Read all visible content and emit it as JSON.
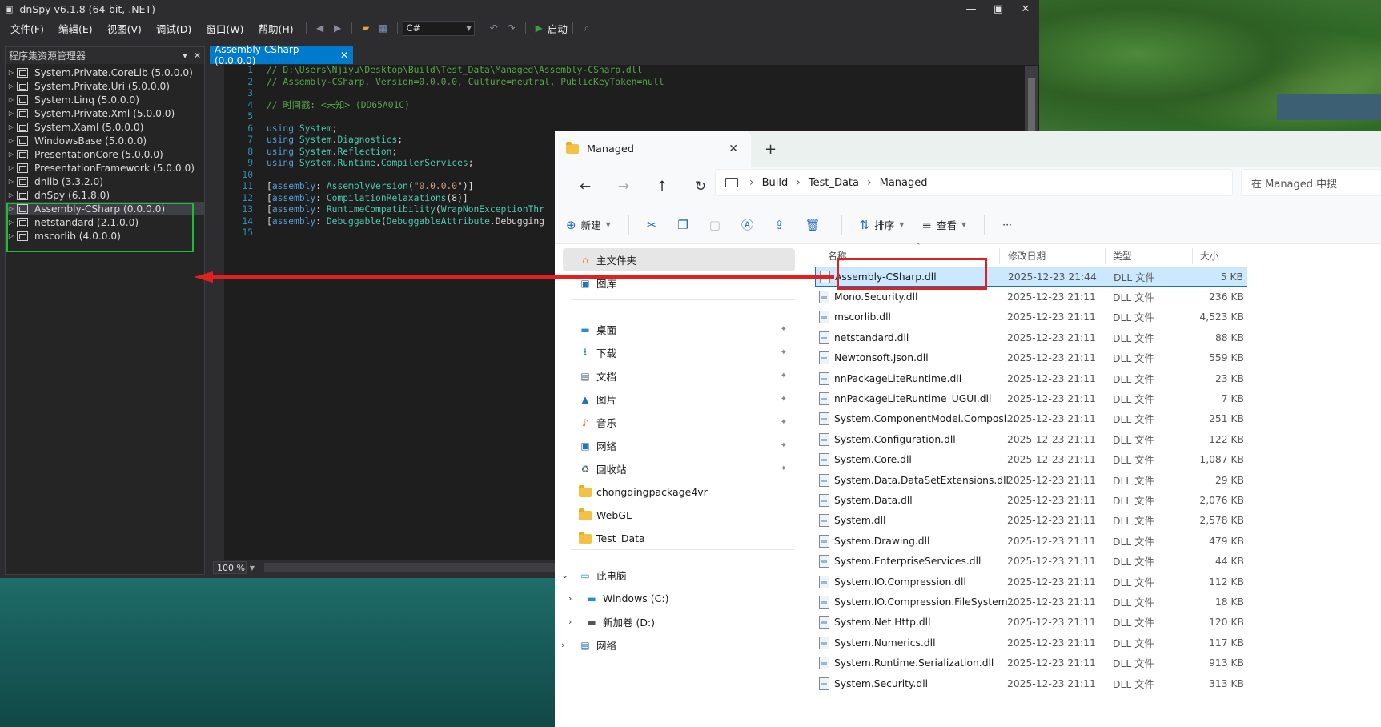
{
  "dnspy": {
    "title": "dnSpy v6.1.8 (64-bit, .NET)",
    "menu": [
      "文件(F)",
      "编辑(E)",
      "视图(V)",
      "调试(D)",
      "窗口(W)",
      "帮助(H)"
    ],
    "language": "C#",
    "start_label": "启动",
    "explorer_title": "程序集资源管理器",
    "tree": [
      "System.Private.CoreLib (5.0.0.0)",
      "System.Private.Uri (5.0.0.0)",
      "System.Linq (5.0.0.0)",
      "System.Private.Xml (5.0.0.0)",
      "System.Xaml (5.0.0.0)",
      "WindowsBase (5.0.0.0)",
      "PresentationCore (5.0.0.0)",
      "PresentationFramework (5.0.0.0)",
      "dnlib (3.3.2.0)",
      "dnSpy (6.1.8.0)",
      "Assembly-CSharp (0.0.0.0)",
      "netstandard (2.1.0.0)",
      "mscorlib (4.0.0.0)"
    ],
    "selected_tree_index": 10,
    "tab_label": "Assembly-CSharp (0.0.0.0)",
    "code": [
      {
        "n": "1",
        "segs": [
          [
            "cmt",
            "// D:\\Users\\Njiyu\\Desktop\\Build\\Test_Data\\Managed\\Assembly-CSharp.dll"
          ]
        ]
      },
      {
        "n": "2",
        "segs": [
          [
            "cmt",
            "// Assembly-CSharp, Version=0.0.0.0, Culture=neutral, PublicKeyToken=null"
          ]
        ]
      },
      {
        "n": "3",
        "segs": []
      },
      {
        "n": "4",
        "segs": [
          [
            "cmt",
            "// 时间戳: <未知> (DD65A01C)"
          ]
        ]
      },
      {
        "n": "5",
        "segs": []
      },
      {
        "n": "6",
        "segs": [
          [
            "kw",
            "using "
          ],
          [
            "ty",
            "System"
          ],
          [
            "pl",
            ";"
          ]
        ]
      },
      {
        "n": "7",
        "segs": [
          [
            "kw",
            "using "
          ],
          [
            "ty",
            "System"
          ],
          [
            "pl",
            "."
          ],
          [
            "ty",
            "Diagnostics"
          ],
          [
            "pl",
            ";"
          ]
        ]
      },
      {
        "n": "8",
        "segs": [
          [
            "kw",
            "using "
          ],
          [
            "ty",
            "System"
          ],
          [
            "pl",
            "."
          ],
          [
            "ty",
            "Reflection"
          ],
          [
            "pl",
            ";"
          ]
        ]
      },
      {
        "n": "9",
        "segs": [
          [
            "kw",
            "using "
          ],
          [
            "ty",
            "System"
          ],
          [
            "pl",
            "."
          ],
          [
            "ty",
            "Runtime"
          ],
          [
            "pl",
            "."
          ],
          [
            "ty",
            "CompilerServices"
          ],
          [
            "pl",
            ";"
          ]
        ]
      },
      {
        "n": "10",
        "segs": []
      },
      {
        "n": "11",
        "segs": [
          [
            "pl",
            "["
          ],
          [
            "kw",
            "assembly"
          ],
          [
            "pl",
            ": "
          ],
          [
            "ty",
            "AssemblyVersion"
          ],
          [
            "pl",
            "("
          ],
          [
            "st",
            "\"0.0.0.0\""
          ],
          [
            "pl",
            ")]"
          ]
        ]
      },
      {
        "n": "12",
        "segs": [
          [
            "pl",
            "["
          ],
          [
            "kw",
            "assembly"
          ],
          [
            "pl",
            ": "
          ],
          [
            "ty",
            "CompilationRelaxations"
          ],
          [
            "pl",
            "(8)]"
          ]
        ]
      },
      {
        "n": "13",
        "segs": [
          [
            "pl",
            "["
          ],
          [
            "kw",
            "assembly"
          ],
          [
            "pl",
            ": "
          ],
          [
            "ty",
            "RuntimeCompatibility"
          ],
          [
            "pl",
            "("
          ],
          [
            "dim",
            "WrapNonExceptionThr"
          ]
        ]
      },
      {
        "n": "14",
        "segs": [
          [
            "pl",
            "["
          ],
          [
            "kw",
            "assembly"
          ],
          [
            "pl",
            ": "
          ],
          [
            "ty",
            "Debuggable"
          ],
          [
            "pl",
            "("
          ],
          [
            "ty",
            "DebuggableAttribute"
          ],
          [
            "pl",
            ".Debugging"
          ]
        ]
      },
      {
        "n": "15",
        "segs": []
      }
    ],
    "zoom": "100 %"
  },
  "explorer": {
    "tab_title": "Managed",
    "breadcrumb": [
      "Build",
      "Test_Data",
      "Managed"
    ],
    "search_placeholder": "在 Managed 中搜",
    "commands": {
      "new": "新建",
      "sort": "排序",
      "view": "查看",
      "more": "···"
    },
    "nav": {
      "home": "主文件夹",
      "gallery": "图库",
      "quick": [
        {
          "label": "桌面",
          "icon": "desktop-icon"
        },
        {
          "label": "下载",
          "icon": "download-icon"
        },
        {
          "label": "文档",
          "icon": "documents-icon"
        },
        {
          "label": "图片",
          "icon": "pictures-icon"
        },
        {
          "label": "音乐",
          "icon": "music-icon"
        },
        {
          "label": "网络",
          "icon": "network-icon"
        },
        {
          "label": "回收站",
          "icon": "recycle-bin-icon"
        }
      ],
      "folders": [
        "chongqingpackage4vr",
        "WebGL",
        "Test_Data"
      ],
      "this_pc": "此电脑",
      "drives": [
        "Windows (C:)",
        "新加卷 (D:)"
      ],
      "network": "网络"
    },
    "columns": {
      "name": "名称",
      "date": "修改日期",
      "type": "类型",
      "size": "大小"
    },
    "files": [
      {
        "name": "Assembly-CSharp.dll",
        "date": "2025-12-23 21:44",
        "type": "DLL 文件",
        "size": "5 KB"
      },
      {
        "name": "Mono.Security.dll",
        "date": "2025-12-23 21:11",
        "type": "DLL 文件",
        "size": "236 KB"
      },
      {
        "name": "mscorlib.dll",
        "date": "2025-12-23 21:11",
        "type": "DLL 文件",
        "size": "4,523 KB"
      },
      {
        "name": "netstandard.dll",
        "date": "2025-12-23 21:11",
        "type": "DLL 文件",
        "size": "88 KB"
      },
      {
        "name": "Newtonsoft.Json.dll",
        "date": "2025-12-23 21:11",
        "type": "DLL 文件",
        "size": "559 KB"
      },
      {
        "name": "nnPackageLiteRuntime.dll",
        "date": "2025-12-23 21:11",
        "type": "DLL 文件",
        "size": "23 KB"
      },
      {
        "name": "nnPackageLiteRuntime_UGUI.dll",
        "date": "2025-12-23 21:11",
        "type": "DLL 文件",
        "size": "7 KB"
      },
      {
        "name": "System.ComponentModel.Compositi...",
        "date": "2025-12-23 21:11",
        "type": "DLL 文件",
        "size": "251 KB"
      },
      {
        "name": "System.Configuration.dll",
        "date": "2025-12-23 21:11",
        "type": "DLL 文件",
        "size": "122 KB"
      },
      {
        "name": "System.Core.dll",
        "date": "2025-12-23 21:11",
        "type": "DLL 文件",
        "size": "1,087 KB"
      },
      {
        "name": "System.Data.DataSetExtensions.dll",
        "date": "2025-12-23 21:11",
        "type": "DLL 文件",
        "size": "29 KB"
      },
      {
        "name": "System.Data.dll",
        "date": "2025-12-23 21:11",
        "type": "DLL 文件",
        "size": "2,076 KB"
      },
      {
        "name": "System.dll",
        "date": "2025-12-23 21:11",
        "type": "DLL 文件",
        "size": "2,578 KB"
      },
      {
        "name": "System.Drawing.dll",
        "date": "2025-12-23 21:11",
        "type": "DLL 文件",
        "size": "479 KB"
      },
      {
        "name": "System.EnterpriseServices.dll",
        "date": "2025-12-23 21:11",
        "type": "DLL 文件",
        "size": "44 KB"
      },
      {
        "name": "System.IO.Compression.dll",
        "date": "2025-12-23 21:11",
        "type": "DLL 文件",
        "size": "112 KB"
      },
      {
        "name": "System.IO.Compression.FileSystem.dll",
        "date": "2025-12-23 21:11",
        "type": "DLL 文件",
        "size": "18 KB"
      },
      {
        "name": "System.Net.Http.dll",
        "date": "2025-12-23 21:11",
        "type": "DLL 文件",
        "size": "120 KB"
      },
      {
        "name": "System.Numerics.dll",
        "date": "2025-12-23 21:11",
        "type": "DLL 文件",
        "size": "117 KB"
      },
      {
        "name": "System.Runtime.Serialization.dll",
        "date": "2025-12-23 21:11",
        "type": "DLL 文件",
        "size": "913 KB"
      },
      {
        "name": "System.Security.dll",
        "date": "2025-12-23 21:11",
        "type": "DLL 文件",
        "size": "313 KB"
      }
    ],
    "selected_file_index": 0
  },
  "colors": {
    "dnspy_accent": "#007acc",
    "highlight_green": "#1dbd3a",
    "highlight_red": "#e12020",
    "explorer_selection": "#cce8ff"
  }
}
